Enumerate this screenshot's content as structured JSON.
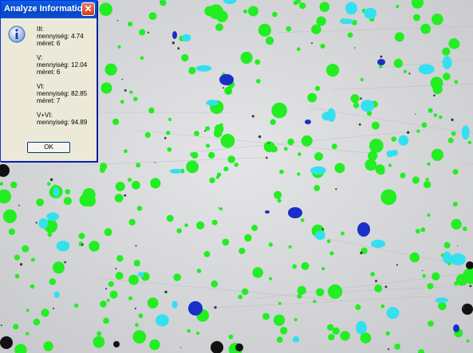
{
  "window": {
    "title": "Analyze Information",
    "close_glyph": "✕"
  },
  "icon": "info-icon",
  "groups": [
    {
      "header": "III:",
      "amount": "mennyiség: 4.74",
      "size": "méret: 6"
    },
    {
      "header": "V:",
      "amount": "mennyiség: 12.04",
      "size": "méret: 6"
    },
    {
      "header": "VI:",
      "amount": "mennyiség: 82.85",
      "size": "méret: 7"
    },
    {
      "header": "V+VI:",
      "amount": "mennyiség: 94.89",
      "size": ""
    }
  ],
  "buttons": {
    "ok": "OK"
  },
  "colors": {
    "background": "#d3d4d6",
    "particle_green": "#22ee22",
    "particle_cyan": "#33e0f0",
    "particle_blue": "#1a2ec8",
    "pore_black": "#111111",
    "titlebar": "#0a4fd0"
  }
}
